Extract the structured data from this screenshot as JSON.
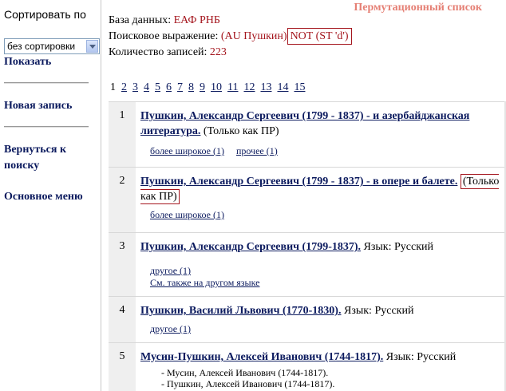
{
  "sidebar": {
    "sort_label": "Сортировать по",
    "sort_value": "без сортировки",
    "show": "Показать",
    "new_record": "Новая запись",
    "back_to_search": "Вернуться к поиску",
    "main_menu": "Основное меню"
  },
  "header": {
    "perm_title": "Пермутационный список",
    "db_label": "База данных:",
    "db_value": "ЕАФ РНБ",
    "query_label": "Поисковое выражение:",
    "query_value": "(AU Пушкин)",
    "query_extra": "NOT (ST 'd')",
    "count_label": "Количество записей:",
    "count_value": "223"
  },
  "pager": {
    "current": "1",
    "pages": [
      "2",
      "3",
      "4",
      "5",
      "6",
      "7",
      "8",
      "9",
      "10",
      "11",
      "12",
      "13",
      "14",
      "15"
    ]
  },
  "records": [
    {
      "num": "1",
      "title": "Пушкин, Александр Сергеевич (1799 - 1837) - и азербайджанская литература.",
      "suffix": "(Только как ПР)",
      "links": [
        "более широкое (1)",
        "прочее (1)"
      ]
    },
    {
      "num": "2",
      "title": "Пушкин, Александр Сергеевич (1799 - 1837) - в опере и балете.",
      "suffix": "(Только как ПР)",
      "links": [
        "более широкое (1)"
      ]
    },
    {
      "num": "3",
      "title": "Пушкин, Александр Сергеевич (1799-1837).",
      "suffix": "Язык: Русский",
      "links": [
        "другое (1)",
        "См. также на другом языке"
      ]
    },
    {
      "num": "4",
      "title": "Пушкин, Василий Львович (1770-1830).",
      "suffix": "Язык: Русский",
      "links": [
        "другое (1)"
      ]
    },
    {
      "num": "5",
      "title": "Мусин-Пушкин, Алексей Иванович (1744-1817).",
      "suffix": "Язык: Русский",
      "sub": [
        "- Мусин, Алексей Иванович (1744-1817).",
        "- Пушкин, Алексей Иванович (1744-1817)."
      ]
    }
  ]
}
